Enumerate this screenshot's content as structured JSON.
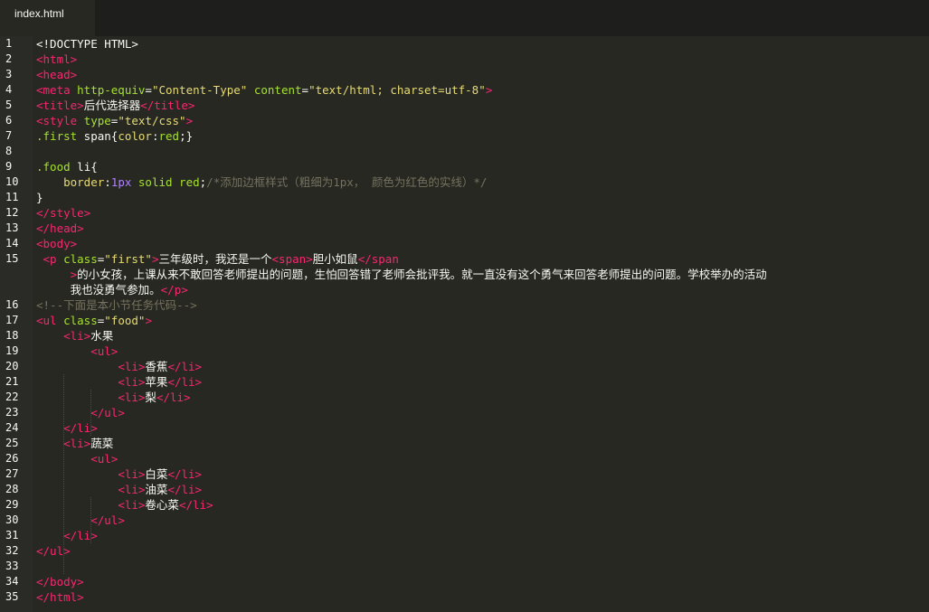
{
  "tab": {
    "label": "index.html"
  },
  "lines": [
    {
      "n": "1",
      "segs": [
        [
          "txt",
          "<!DOCTYPE HTML>"
        ]
      ]
    },
    {
      "n": "2",
      "segs": [
        [
          "tag",
          "<html>"
        ]
      ]
    },
    {
      "n": "3",
      "segs": [
        [
          "tag",
          "<head>"
        ]
      ]
    },
    {
      "n": "4",
      "segs": [
        [
          "tag",
          "<meta "
        ],
        [
          "attr",
          "http-equiv"
        ],
        [
          "txt",
          "="
        ],
        [
          "str",
          "\"Content-Type\""
        ],
        [
          "txt",
          " "
        ],
        [
          "attr",
          "content"
        ],
        [
          "txt",
          "="
        ],
        [
          "str",
          "\"text/html; charset=utf-8\""
        ],
        [
          "tag",
          ">"
        ]
      ]
    },
    {
      "n": "5",
      "segs": [
        [
          "tag",
          "<title>"
        ],
        [
          "txt",
          "后代选择器"
        ],
        [
          "tag",
          "</title>"
        ]
      ]
    },
    {
      "n": "6",
      "segs": [
        [
          "tag",
          "<style "
        ],
        [
          "attr",
          "type"
        ],
        [
          "txt",
          "="
        ],
        [
          "str",
          "\"text/css\""
        ],
        [
          "tag",
          ">"
        ]
      ]
    },
    {
      "n": "7",
      "segs": [
        [
          "sel",
          ".first"
        ],
        [
          "txt",
          " span{"
        ],
        [
          "prop",
          "color"
        ],
        [
          "txt",
          ":"
        ],
        [
          "sel",
          "red"
        ],
        [
          "txt",
          ";}"
        ]
      ]
    },
    {
      "n": "8",
      "segs": []
    },
    {
      "n": "9",
      "segs": [
        [
          "sel",
          ".food"
        ],
        [
          "txt",
          " li{"
        ]
      ]
    },
    {
      "n": "10",
      "segs": [
        [
          "txt",
          "    "
        ],
        [
          "prop",
          "border"
        ],
        [
          "txt",
          ":"
        ],
        [
          "num",
          "1px"
        ],
        [
          "txt",
          " "
        ],
        [
          "sel",
          "solid red"
        ],
        [
          "txt",
          ";"
        ],
        [
          "cmt",
          "/*添加边框样式（粗细为1px， 颜色为红色的实线）*/"
        ]
      ]
    },
    {
      "n": "11",
      "segs": [
        [
          "txt",
          "}"
        ]
      ]
    },
    {
      "n": "12",
      "segs": [
        [
          "tag",
          "</style>"
        ]
      ]
    },
    {
      "n": "13",
      "segs": [
        [
          "tag",
          "</head>"
        ]
      ]
    },
    {
      "n": "14",
      "segs": [
        [
          "tag",
          "<body>"
        ]
      ]
    },
    {
      "n": "15",
      "segs": [
        [
          "txt",
          " "
        ],
        [
          "tag",
          "<p "
        ],
        [
          "attr",
          "class"
        ],
        [
          "txt",
          "="
        ],
        [
          "str",
          "\"first\""
        ],
        [
          "tag",
          ">"
        ],
        [
          "txt",
          "三年级时，我还是一个"
        ],
        [
          "tag",
          "<span>"
        ],
        [
          "txt",
          "胆小如鼠"
        ],
        [
          "tag",
          "</span"
        ]
      ]
    },
    {
      "n": "",
      "segs": [
        [
          "txt",
          "     "
        ],
        [
          "tag",
          ">"
        ],
        [
          "txt",
          "的小女孩，上课从来不敢回答老师提出的问题，生怕回答错了老师会批评我。就一直没有这个勇气来回答老师提出的问题。学校举办的活动"
        ]
      ]
    },
    {
      "n": "",
      "segs": [
        [
          "txt",
          "     我也没勇气参加。"
        ],
        [
          "tag",
          "</p>"
        ]
      ]
    },
    {
      "n": "16",
      "segs": [
        [
          "cmt",
          "<!--下面是本小节任务代码-->"
        ]
      ]
    },
    {
      "n": "17",
      "segs": [
        [
          "tag",
          "<ul "
        ],
        [
          "attr",
          "class"
        ],
        [
          "txt",
          "="
        ],
        [
          "str",
          "\"food\""
        ],
        [
          "tag",
          ">"
        ]
      ]
    },
    {
      "n": "18",
      "segs": [
        [
          "txt",
          "    "
        ],
        [
          "tag",
          "<li>"
        ],
        [
          "txt",
          "水果"
        ]
      ]
    },
    {
      "n": "19",
      "segs": [
        [
          "txt",
          "        "
        ],
        [
          "tag",
          "<ul>"
        ]
      ]
    },
    {
      "n": "20",
      "segs": [
        [
          "txt",
          "            "
        ],
        [
          "tag",
          "<li>"
        ],
        [
          "txt",
          "香蕉"
        ],
        [
          "tag",
          "</li>"
        ]
      ]
    },
    {
      "n": "21",
      "segs": [
        [
          "txt",
          "            "
        ],
        [
          "tag",
          "<li>"
        ],
        [
          "txt",
          "苹果"
        ],
        [
          "tag",
          "</li>"
        ]
      ]
    },
    {
      "n": "22",
      "segs": [
        [
          "txt",
          "            "
        ],
        [
          "tag",
          "<li>"
        ],
        [
          "txt",
          "梨"
        ],
        [
          "tag",
          "</li>"
        ]
      ]
    },
    {
      "n": "23",
      "segs": [
        [
          "txt",
          "        "
        ],
        [
          "tag",
          "</ul>"
        ]
      ]
    },
    {
      "n": "24",
      "segs": [
        [
          "txt",
          "    "
        ],
        [
          "tag",
          "</li>"
        ]
      ]
    },
    {
      "n": "25",
      "segs": [
        [
          "txt",
          "    "
        ],
        [
          "tag",
          "<li>"
        ],
        [
          "txt",
          "蔬菜"
        ]
      ]
    },
    {
      "n": "26",
      "segs": [
        [
          "txt",
          "        "
        ],
        [
          "tag",
          "<ul>"
        ]
      ]
    },
    {
      "n": "27",
      "segs": [
        [
          "txt",
          "            "
        ],
        [
          "tag",
          "<li>"
        ],
        [
          "txt",
          "白菜"
        ],
        [
          "tag",
          "</li>"
        ]
      ]
    },
    {
      "n": "28",
      "segs": [
        [
          "txt",
          "            "
        ],
        [
          "tag",
          "<li>"
        ],
        [
          "txt",
          "油菜"
        ],
        [
          "tag",
          "</li>"
        ]
      ]
    },
    {
      "n": "29",
      "segs": [
        [
          "txt",
          "            "
        ],
        [
          "tag",
          "<li>"
        ],
        [
          "txt",
          "卷心菜"
        ],
        [
          "tag",
          "</li>"
        ]
      ]
    },
    {
      "n": "30",
      "segs": [
        [
          "txt",
          "        "
        ],
        [
          "tag",
          "</ul>"
        ]
      ]
    },
    {
      "n": "31",
      "segs": [
        [
          "txt",
          "    "
        ],
        [
          "tag",
          "</li>"
        ]
      ]
    },
    {
      "n": "32",
      "segs": [
        [
          "tag",
          "</ul>"
        ]
      ]
    },
    {
      "n": "33",
      "segs": []
    },
    {
      "n": "34",
      "segs": [
        [
          "tag",
          "</body>"
        ]
      ]
    },
    {
      "n": "35",
      "segs": [
        [
          "tag",
          "</html>"
        ]
      ]
    }
  ]
}
